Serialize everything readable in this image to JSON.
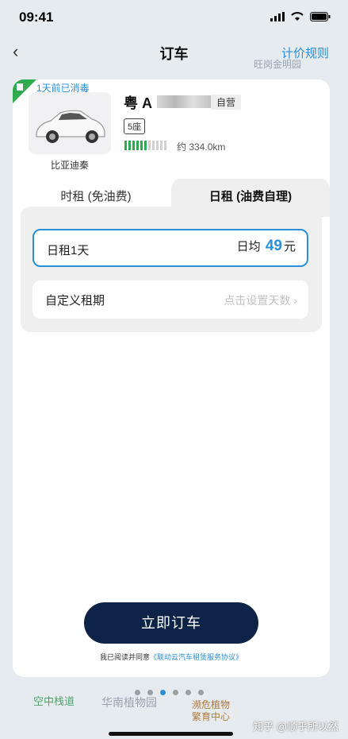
{
  "status": {
    "time": "09:41"
  },
  "nav": {
    "title": "订车",
    "rules": "计价规则"
  },
  "vehicle": {
    "disinfect": "1天前已消毒",
    "plate_prefix": "粤 A",
    "self_badge": "自营",
    "seats": "5座",
    "battery_level": 0.55,
    "range": "约 334.0km",
    "name": "比亚迪秦"
  },
  "tabs": [
    {
      "label": "时租 (免油费)"
    },
    {
      "label": "日租 (油费自理)"
    }
  ],
  "options": {
    "day": {
      "label": "日租1天",
      "price_prefix": "日均",
      "price": "49",
      "price_unit": "元"
    },
    "custom": {
      "label": "自定义租期",
      "hint": "点击设置天数 ›"
    }
  },
  "order_button": "立即订车",
  "agreement": {
    "prefix": "我已阅读并同意",
    "link": "《联动云汽车租赁服务协议》"
  },
  "map_labels": {
    "top": "旺岗金明园",
    "bottom1": "空中栈道",
    "bottom2": "华南植物园",
    "bottom3": "濒危植物",
    "bottom4": "繁育中心"
  },
  "watermark": "知乎 @顺乎所以然",
  "colors": {
    "accent": "#2a8fd8",
    "button": "#0d2347",
    "battery": "#2eaa4f"
  }
}
